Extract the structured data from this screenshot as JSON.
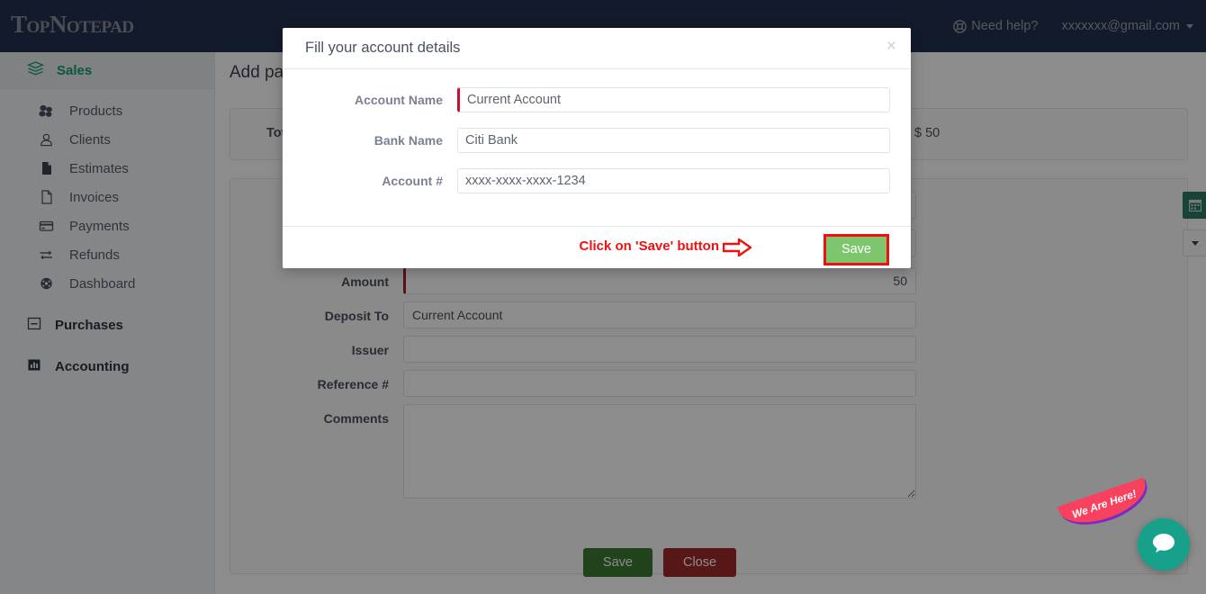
{
  "navbar": {
    "brand": "TopNotepad",
    "help_label": "Need help?",
    "help_icon": "lifebuoy-icon",
    "user_email": "xxxxxxx@gmail.com",
    "caret_icon": "chevron-down-icon",
    "bg_color": "#24304f"
  },
  "sidebar": {
    "header": {
      "label": "Sales",
      "icon": "layers-icon",
      "color": "#17a06b"
    },
    "items": [
      {
        "label": "Products",
        "icon": "cubes-icon"
      },
      {
        "label": "Clients",
        "icon": "user-circle-icon"
      },
      {
        "label": "Estimates",
        "icon": "file-filled-icon"
      },
      {
        "label": "Invoices",
        "icon": "file-outline-icon"
      },
      {
        "label": "Payments",
        "icon": "credit-card-icon"
      },
      {
        "label": "Refunds",
        "icon": "exchange-arrows-icon"
      },
      {
        "label": "Dashboard",
        "icon": "gauge-icon"
      }
    ],
    "groups": [
      {
        "label": "Purchases",
        "icon": "minus-square-icon"
      },
      {
        "label": "Accounting",
        "icon": "bar-chart-icon"
      }
    ]
  },
  "page": {
    "title": "Add payment",
    "total_panel": {
      "label": "Total",
      "amount": "$ 50"
    },
    "form": {
      "rows": [
        {
          "label": "Amount",
          "value": "50",
          "required": true,
          "align": "right"
        },
        {
          "label": "Deposit To",
          "value": "Current Account",
          "required": false,
          "align": "left"
        },
        {
          "label": "Issuer",
          "value": "",
          "required": false,
          "align": "left"
        },
        {
          "label": "Reference #",
          "value": "",
          "required": false,
          "align": "left"
        }
      ],
      "comments_label": "Comments",
      "comments_value": "",
      "date_button_icon": "calendar-icon",
      "select_caret_icon": "chevron-down-icon",
      "save_label": "Save",
      "close_label": "Close",
      "save_color": "#3d7b33",
      "close_color": "#9e2b2b"
    }
  },
  "modal": {
    "title": "Fill your account details",
    "close_icon": "close-icon",
    "close_glyph": "×",
    "fields": [
      {
        "label": "Account Name",
        "value": "Current Account",
        "placeholder": "",
        "required": true
      },
      {
        "label": "Bank Name",
        "value": "Citi Bank",
        "placeholder": "",
        "required": false
      },
      {
        "label": "Account #",
        "value": "xxxx-xxxx-xxxx-1234",
        "placeholder": "",
        "required": false
      }
    ],
    "save_label": "Save",
    "save_bg_color": "#7dc66d",
    "highlight_color": "#f01010"
  },
  "annotation": {
    "text": "Click on 'Save' button",
    "arrow_icon": "arrow-right-outline-icon",
    "color": "#f01010"
  },
  "chat_widget": {
    "tag_text": "We Are Here!",
    "icon": "chat-bubble-icon",
    "circle_color": "#17a08a",
    "tag_color": "#f6425f"
  }
}
